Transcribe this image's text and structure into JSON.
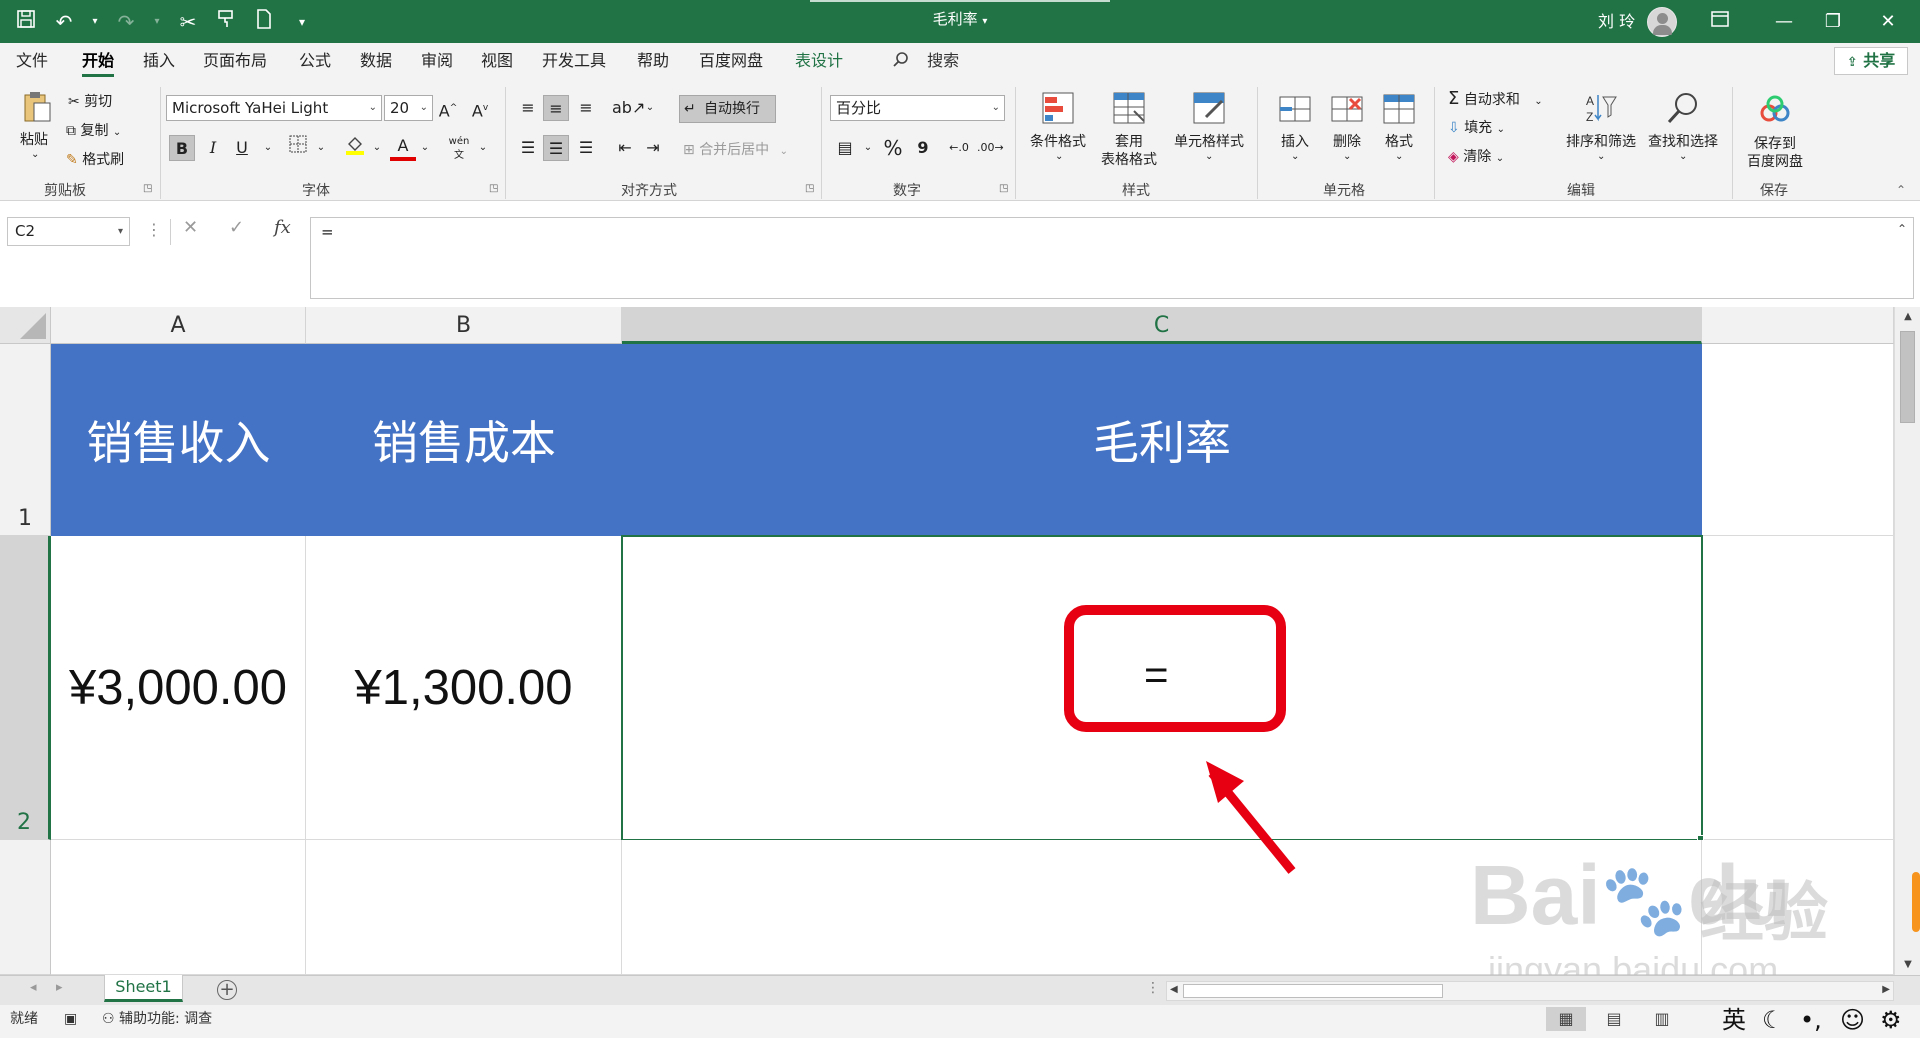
{
  "window": {
    "title": "毛利率",
    "title_caret": "▾",
    "user_name": "刘 玲",
    "ribbon_display_icon": "ribbon-display-icon",
    "minimize": "—",
    "restore": "❐",
    "close": "✕"
  },
  "qat": {
    "icons": [
      "save-icon",
      "undo-icon",
      "redo-icon",
      "cut-icon",
      "format-painter-icon",
      "new-file-icon",
      "customize-qat-icon"
    ]
  },
  "tabs": [
    {
      "label": "文件"
    },
    {
      "label": "开始"
    },
    {
      "label": "插入"
    },
    {
      "label": "页面布局"
    },
    {
      "label": "公式"
    },
    {
      "label": "数据"
    },
    {
      "label": "审阅"
    },
    {
      "label": "视图"
    },
    {
      "label": "开发工具"
    },
    {
      "label": "帮助"
    },
    {
      "label": "百度网盘"
    },
    {
      "label": "表设计"
    }
  ],
  "search_label": "搜索",
  "share_label": "共享",
  "ribbon": {
    "clipboard": {
      "paste": "粘贴",
      "cut": "剪切",
      "copy": "复制",
      "painter": "格式刷",
      "group": "剪贴板"
    },
    "font": {
      "name": "Microsoft YaHei Light",
      "size": "20",
      "group": "字体",
      "bold": "B",
      "italic": "I",
      "underline": "U",
      "phonetic": "wén"
    },
    "alignment": {
      "wrap": "自动换行",
      "merge": "合并后居中",
      "group": "对齐方式"
    },
    "number": {
      "format": "百分比",
      "group": "数字",
      "percent": "%",
      "comma": "9"
    },
    "styles": {
      "conditional": "条件格式",
      "table_1": "套用",
      "table_2": "表格格式",
      "cell_styles": "单元格样式",
      "group": "样式"
    },
    "cells": {
      "insert": "插入",
      "delete": "删除",
      "format": "格式",
      "group": "单元格"
    },
    "editing": {
      "autosum": "自动求和",
      "fill": "填充",
      "clear": "清除",
      "sort": "排序和筛选",
      "find": "查找和选择",
      "group": "编辑"
    },
    "save": {
      "label_1": "保存到",
      "label_2": "百度网盘",
      "group": "保存"
    }
  },
  "formula_bar": {
    "name_box": "C2",
    "fx": "fx",
    "content": "="
  },
  "sheet": {
    "columns": [
      "A",
      "B",
      "C"
    ],
    "rows": [
      "1",
      "2"
    ],
    "header_row": [
      "销售收入",
      "销售成本",
      "毛利率"
    ],
    "data_row": [
      "¥3,000.00",
      "¥1,300.00",
      "="
    ],
    "header_fill": "#4472C4",
    "selected_cell": "C2"
  },
  "annotation": {
    "color": "#E60012"
  },
  "watermark": {
    "brand": "Bai",
    "brand2": "du",
    "cn": "经验",
    "url": "jingyan.baidu.com"
  },
  "sheet_tabs": {
    "active": "Sheet1",
    "add": "+"
  },
  "status": {
    "ready": "就绪",
    "accessibility": "辅助功能: 调查",
    "ime_lang": "英",
    "ime_icons": [
      "moon-icon",
      "punctuation-icon",
      "emoji-icon",
      "settings-icon"
    ]
  },
  "colors": {
    "accent": "#217346"
  }
}
